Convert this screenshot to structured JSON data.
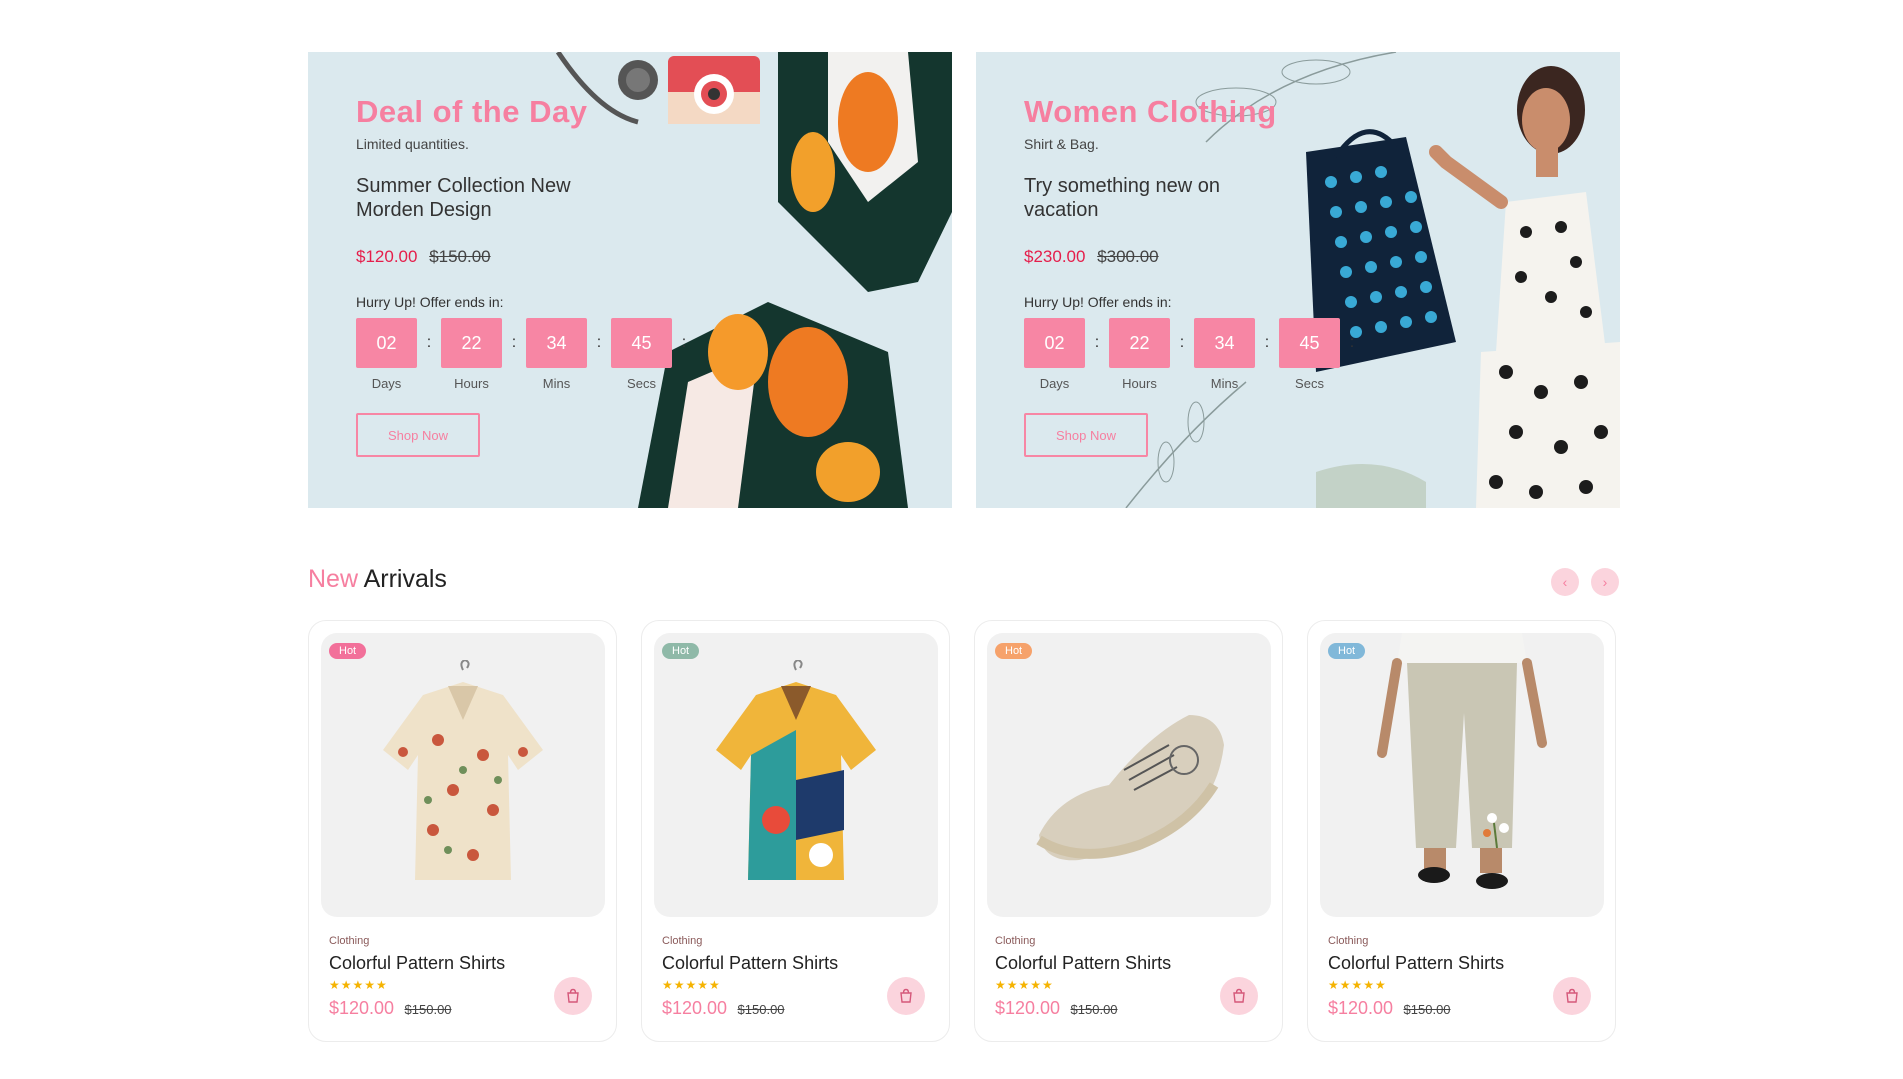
{
  "banners": [
    {
      "title": "Deal of the Day",
      "subtitle": "Limited quantities.",
      "headline": "Summer Collection New Morden Design",
      "price": "$120.00",
      "old_price": "$150.00",
      "hurry": "Hurry Up! Offer ends in:",
      "countdown": [
        {
          "value": "02",
          "label": "Days"
        },
        {
          "value": "22",
          "label": "Hours"
        },
        {
          "value": "34",
          "label": "Mins"
        },
        {
          "value": "45",
          "label": "Secs"
        }
      ],
      "button": "Shop Now"
    },
    {
      "title": "Women Clothing",
      "subtitle": "Shirt & Bag.",
      "headline": "Try something new on vacation",
      "price": "$230.00",
      "old_price": "$300.00",
      "hurry": "Hurry Up! Offer ends in:",
      "countdown": [
        {
          "value": "02",
          "label": "Days"
        },
        {
          "value": "22",
          "label": "Hours"
        },
        {
          "value": "34",
          "label": "Mins"
        },
        {
          "value": "45",
          "label": "Secs"
        }
      ],
      "button": "Shop Now"
    }
  ],
  "colon": ":",
  "arrivals": {
    "title_highlight": "New",
    "title_rest": "Arrivals",
    "prev_icon": "chevron-left-icon",
    "next_icon": "chevron-right-icon",
    "prev_glyph": "‹",
    "next_glyph": "›"
  },
  "products": [
    {
      "badge": "Hot",
      "badge_color": "#f2709a",
      "category": "Clothing",
      "name": "Colorful Pattern Shirts",
      "stars": "★★★★★",
      "rating": 5,
      "price": "$120.00",
      "old_price": "$150.00",
      "image": "mushroom-shirt"
    },
    {
      "badge": "Hot",
      "badge_color": "#8fb9a8",
      "category": "Clothing",
      "name": "Colorful Pattern Shirts",
      "stars": "★★★★★",
      "rating": 5,
      "price": "$120.00",
      "old_price": "$150.00",
      "image": "colorblock-shirt"
    },
    {
      "badge": "Hot",
      "badge_color": "#f6a26b",
      "category": "Clothing",
      "name": "Colorful Pattern Shirts",
      "stars": "★★★★★",
      "rating": 5,
      "price": "$120.00",
      "old_price": "$150.00",
      "image": "beige-shoe"
    },
    {
      "badge": "Hot",
      "badge_color": "#81b8d9",
      "category": "Clothing",
      "name": "Colorful Pattern Shirts",
      "stars": "★★★★★",
      "rating": 5,
      "price": "$120.00",
      "old_price": "$150.00",
      "image": "linen-pants"
    }
  ],
  "colors": {
    "accent": "#f67fa0",
    "countdown_bg": "#f786a4",
    "sale_price": "#e51e4b",
    "banner_bg": "#dbe9ee"
  }
}
